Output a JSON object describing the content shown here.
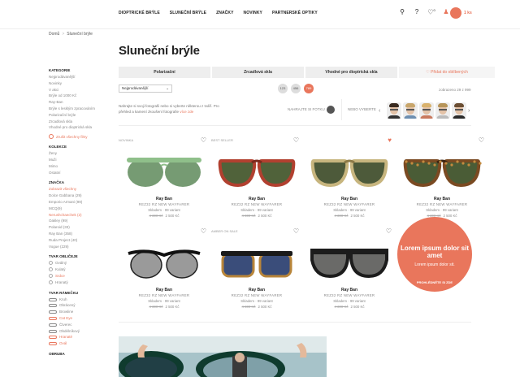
{
  "header": {
    "nav": [
      "DIOPTRICKÉ BRÝLE",
      "SLUNEČNÍ BRÝLE",
      "ZNAČKY",
      "NOVINKY",
      "PARTNERSKÉ OPTIKY"
    ],
    "icons": [
      "search-icon",
      "help-icon",
      "heart-icon",
      "user-icon"
    ],
    "wishlist_count": "0",
    "cart": "1 ks"
  },
  "breadcrumb": {
    "home": "Domů",
    "current": "Sluneční brýle",
    "sep": ">"
  },
  "page_title": "Sluneční brýle",
  "tabs": [
    "Polarizační",
    "Zrcadlová skla",
    "Vhodné pro dioptrická skla",
    "Přidat do oblíbených"
  ],
  "sort": {
    "value": "Nejprodávanější",
    "arrow": "⌄"
  },
  "views": [
    "123",
    "456",
    "789"
  ],
  "count": "zobrazeno 29 z 999",
  "hint": {
    "text": "Nahrajte si svoji fotografii nebo si vyberte některou z tváří. Pro přehled a kamení zkoušení fotografie",
    "link": "více zde"
  },
  "fit_label": "NAHRAJTE SI FOTKU",
  "faces_label": "NEBO VYBERTE",
  "arrows": {
    "left": "‹",
    "right": "›"
  },
  "face_colors": [
    {
      "hair": "#3a2b20",
      "shirt": "#333"
    },
    {
      "hair": "#c8a66b",
      "shirt": "#6e8fb0"
    },
    {
      "hair": "#d9b26d",
      "shirt": "#c97a5e"
    },
    {
      "hair": "#b7955a",
      "shirt": "#bbb"
    },
    {
      "hair": "#6b4e33",
      "shirt": "#2b2b2b"
    }
  ],
  "sidebar": {
    "kategorie": {
      "h": "Kategorie",
      "items": [
        "Nejprodávanější",
        "Novinky",
        "V akci",
        "Brýle od 1000 Kč",
        "Ray-Ban",
        "Brýle s lesklým zpracováním",
        "Polarizační brýle",
        "Zrcadlová skla",
        "Vhodné pro dioptrická skla"
      ]
    },
    "clear": "Zrušit všechny filtry",
    "kolekce": {
      "h": "Kolekce",
      "items": [
        "Ženy",
        "Muži",
        "Mimo",
        "Ostatní"
      ]
    },
    "znacka": {
      "h": "Značka",
      "items": [
        "Zobrazit všechny",
        "Dolce Gabbana (29)",
        "Emporio Armani (99)",
        "MCQ(9)",
        "Nerushchaechek (2)",
        "Oakley (99)",
        "Polaroid (33)",
        "Ray Ban (358)",
        "Ruda Project (40)",
        "Vogue (229)"
      ]
    },
    "tvar": {
      "h": "Tvar obličeje",
      "items": [
        "Oválný",
        "Kulatý",
        "Srdce",
        "Hranatý"
      ]
    },
    "ramecek": {
      "h": "Tvar rámečku",
      "items": [
        "Kruh",
        "Obrácený",
        "Browline",
        "Cat Eye",
        "Čtverec",
        "Obdélníkový",
        "Hranaté",
        "Ovál"
      ]
    },
    "obruba": {
      "h": "Obruba"
    }
  },
  "products": [
    {
      "flag": "NOVINKA",
      "brand": "Ray Ban",
      "model": "REZ32 RZ NEW WAYFARER",
      "variants": "Skladem · 99 variant",
      "old": "4 300 Kč",
      "price": "2 500 Kč",
      "fav": false,
      "frame": "#8fbf8a",
      "lens": "#5e8a5a",
      "rim": "none",
      "type": "round"
    },
    {
      "flag": "BEST SELLER",
      "brand": "Ray Ban",
      "model": "REZ32 RZ NEW WAYFARER",
      "variants": "Skladem · 99 variant",
      "old": "4 300 Kč",
      "price": "2 500 Kč",
      "fav": false,
      "frame": "#b1402f",
      "lens": "#50623a",
      "rim": "#7a2a1e",
      "type": "aviator"
    },
    {
      "flag": "",
      "brand": "Ray Ban",
      "model": "REZ32 RZ NEW WAYFARER",
      "variants": "Skladem · 99 variant",
      "old": "4 300 Kč",
      "price": "2 500 Kč",
      "fav": true,
      "frame": "#c7b57e",
      "lens": "#4d5a3a",
      "rim": "#8c7a48",
      "type": "aviator"
    },
    {
      "flag": "",
      "brand": "Ray Ban",
      "model": "REZ32 RZ NEW WAYFARER",
      "variants": "Skladem · 99 variant",
      "old": "4 300 Kč",
      "price": "2 500 Kč",
      "fav": false,
      "frame": "#7a4a22",
      "lens": "#4a5c36",
      "rim": "#3a2412",
      "type": "tort"
    },
    {
      "flag": "",
      "brand": "Ray Ban",
      "model": "REZ32 RZ NEW WAYFARER",
      "variants": "Skladem · 99 variant",
      "old": "4 300 Kč",
      "price": "2 500 Kč",
      "fav": false,
      "frame": "#222",
      "lens": "#9a9a9a",
      "rim": "#111",
      "type": "browround"
    },
    {
      "flag": "AMBER ON SALE",
      "brand": "Ray Ban",
      "model": "REZ32 RZ NEW WAYFARER",
      "variants": "Skladem · 99 variant",
      "old": "4 300 Kč",
      "price": "2 500 Kč",
      "fav": false,
      "frame": "#b8853a",
      "lens": "#3a4d7a",
      "rim": "#1a1a1a",
      "type": "browsq"
    },
    {
      "flag": "",
      "brand": "Ray Ban",
      "model": "REZ32 RZ NEW WAYFARER",
      "variants": "Skladem · 99 variant",
      "old": "4 300 Kč",
      "price": "2 500 Kč",
      "fav": false,
      "frame": "#1c1c1c",
      "lens": "#6a6a68",
      "rim": "#1c1c1c",
      "type": "wayfarer"
    }
  ],
  "promo": {
    "title": "Lorem ipsum dolor sit amet",
    "sub": "Lorem ipsum dolor sit.",
    "cta": "PROHLÉDNĚTE SI ZDE"
  }
}
